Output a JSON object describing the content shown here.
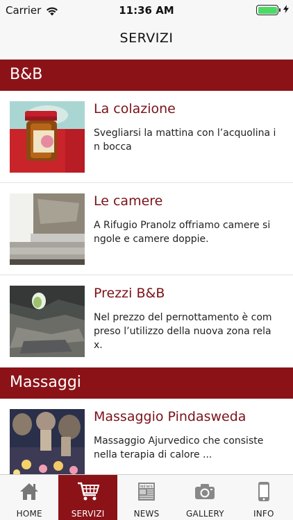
{
  "status_bar": {
    "carrier": "Carrier",
    "time": "11:36 AM",
    "battery_color": "#4cd964"
  },
  "nav": {
    "title": "SERVIZI"
  },
  "sections": [
    {
      "title": "B&B",
      "items": [
        {
          "title": "La colazione",
          "description": "Svegliarsi la mattina con l’acquolina i\nn bocca",
          "image": "jam-jar-photo"
        },
        {
          "title": "Le camere",
          "description": "A Rifugio Pranolz offriamo camere si\nngole e camere doppie.",
          "image": "room-bed-photo"
        },
        {
          "title": "Prezzi B&B",
          "description": "Nel prezzo del pernottamento è com\npreso l’utilizzo della nuova zona rela\nx.",
          "image": "cave-photo"
        }
      ]
    },
    {
      "title": "Massaggi",
      "items": [
        {
          "title": "Massaggio Pindasweda",
          "description": "Massaggio Ajurvedico che consiste\nnella terapia di calore ...",
          "image": "candles-massage-photo"
        }
      ]
    }
  ],
  "tab_bar": {
    "accent": "#8b1318",
    "tabs": [
      {
        "label": "HOME",
        "icon": "home-icon",
        "active": false
      },
      {
        "label": "SERVIZI",
        "icon": "cart-icon",
        "active": true
      },
      {
        "label": "NEWS",
        "icon": "newspaper-icon",
        "active": false
      },
      {
        "label": "GALLERY",
        "icon": "camera-icon",
        "active": false
      },
      {
        "label": "INFO",
        "icon": "phone-icon",
        "active": false
      }
    ]
  }
}
